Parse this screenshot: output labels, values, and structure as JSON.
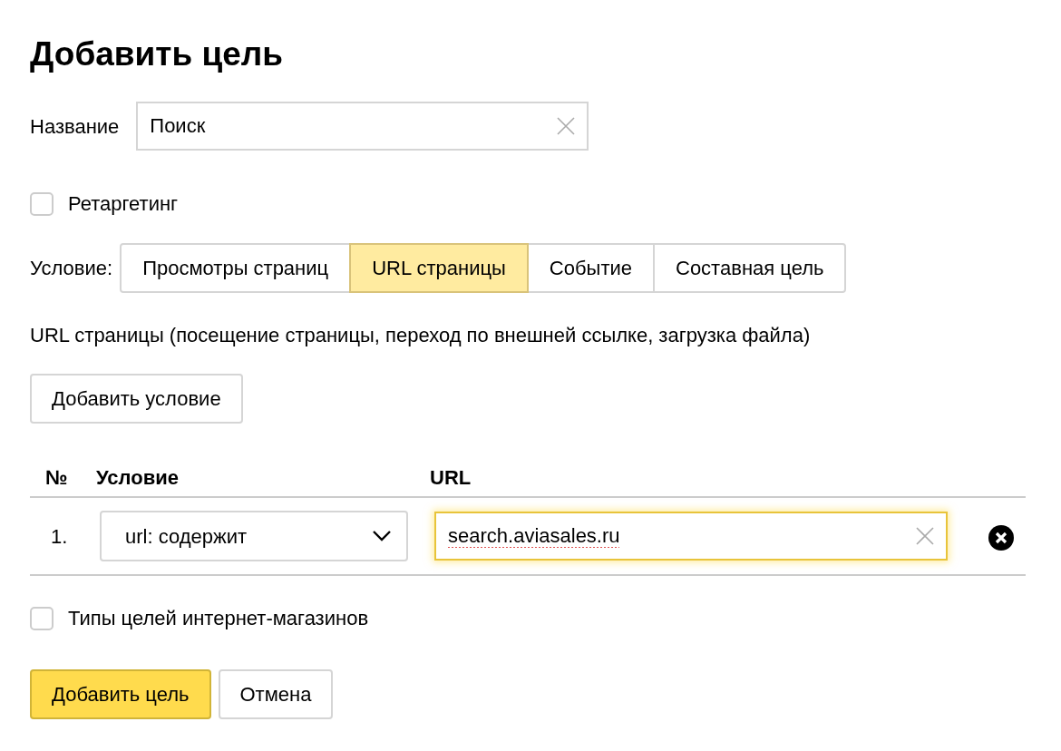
{
  "title": "Добавить цель",
  "name_field": {
    "label": "Название",
    "value": "Поиск"
  },
  "retargeting": {
    "label": "Ретаргетинг",
    "checked": false
  },
  "condition": {
    "label": "Условие:",
    "tabs": [
      {
        "label": "Просмотры страниц",
        "selected": false
      },
      {
        "label": "URL страницы",
        "selected": true
      },
      {
        "label": "Событие",
        "selected": false
      },
      {
        "label": "Составная цель",
        "selected": false
      }
    ]
  },
  "description": "URL страницы (посещение страницы, переход по внешней ссылке, загрузка файла)",
  "add_condition_button": "Добавить условие",
  "table": {
    "columns": [
      "№",
      "Условие",
      "URL"
    ],
    "rows": [
      {
        "number": "1.",
        "condition": "url: содержит",
        "url": "search.aviasales.ru",
        "focused": true
      }
    ]
  },
  "shop_goals": {
    "label": "Типы целей интернет-магазинов",
    "checked": false
  },
  "buttons": [
    {
      "label": "Добавить цель",
      "kind": "primary"
    },
    {
      "label": "Отмена",
      "kind": "secondary"
    }
  ]
}
